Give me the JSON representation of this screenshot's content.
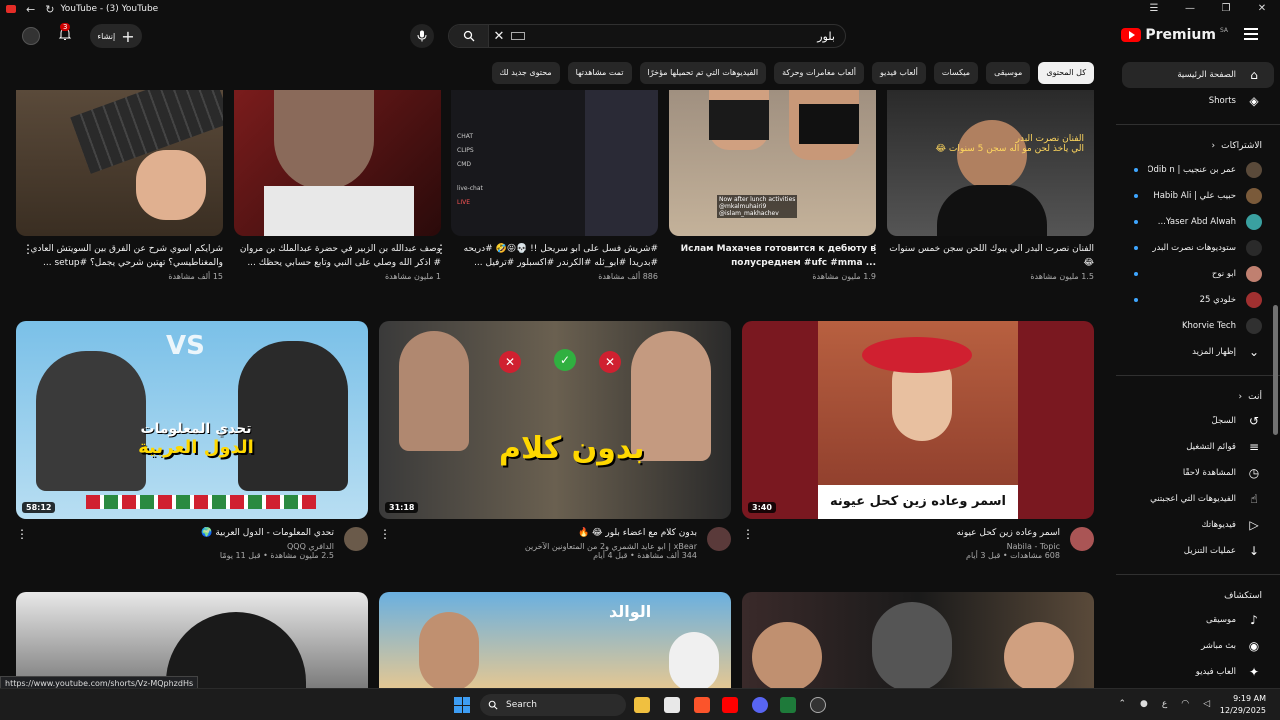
{
  "window": {
    "title": "YouTube - (3) YouTube",
    "back": "←",
    "reload": "↻",
    "controls": [
      "☰",
      "—",
      "❐",
      "✕"
    ]
  },
  "masthead": {
    "logo_text": "Premium",
    "region": "SA",
    "search_value": "بلور",
    "create_label": "إنشاء",
    "create_plus": "+",
    "notification_count": "3"
  },
  "chips": [
    "كل المحتوى",
    "موسيقى",
    "ميكسات",
    "ألعاب فيديو",
    "ألعاب مغامرات وحركة",
    "الفيديوهات التي تم تحميلها مؤخرًا",
    "تمت مشاهدتها",
    "محتوى جديد لك"
  ],
  "sidebar": {
    "main": [
      {
        "label": "الصفحة الرئيسية",
        "icon": "home-icon"
      },
      {
        "label": "Shorts",
        "icon": "shorts-icon"
      }
    ],
    "subs_title": "الاشتراكات",
    "subs_chev": "‹",
    "subs": [
      {
        "label": "عمر بن عنجيب | Odib n...",
        "color": "#5a4a3a"
      },
      {
        "label": "حبيب علي | Habib Ali",
        "color": "#7a5a3a"
      },
      {
        "label": "Yaser Abd Alwah...",
        "color": "#3aa0a0"
      },
      {
        "label": "ستوديوهات نصرت البدر",
        "color": "#2a2a2a"
      },
      {
        "label": "ابو نوح",
        "color": "#c08070"
      },
      {
        "label": "خلودي 25",
        "color": "#a03030"
      },
      {
        "label": "Khorvie Tech",
        "color": "#303030"
      }
    ],
    "show_more": "إظهار المزيد",
    "you_title": "أنت",
    "you_chev": "‹",
    "you": [
      {
        "label": "السجلّ",
        "icon": "history-icon",
        "glyph": "↺"
      },
      {
        "label": "قوائم التشغيل",
        "icon": "playlists-icon",
        "glyph": "≡"
      },
      {
        "label": "المشاهدة لاحقًا",
        "icon": "watch-later-icon",
        "glyph": "◷"
      },
      {
        "label": "الفيديوهات التي أعجبتني",
        "icon": "like-icon",
        "glyph": "☝"
      },
      {
        "label": "فيديوهاتك",
        "icon": "your-videos-icon",
        "glyph": "▷"
      },
      {
        "label": "عمليات التنزيل",
        "icon": "download-icon",
        "glyph": "↓"
      }
    ],
    "explore_title": "استكشاف",
    "explore": [
      {
        "label": "موسيقى",
        "icon": "music-icon",
        "glyph": "♪"
      },
      {
        "label": "بث مباشر",
        "icon": "live-icon",
        "glyph": "◉"
      },
      {
        "label": "ألعاب فيديو",
        "icon": "gaming-icon",
        "glyph": "✦"
      }
    ]
  },
  "row1": [
    {
      "title": "الفنان نصرت البدر الي يبوك اللحن سجن خمس سنوات 😂",
      "views": "1.5 مليون مشاهدة",
      "bg": "#3a3a3a"
    },
    {
      "title": "Ислам Махачев готовится к дебюту в полусреднем #ufc #mma ...",
      "views": "1.9 مليون مشاهدة",
      "bg": "#8a7a66"
    },
    {
      "title": "#شريش فسل على ابو سريحل !! 💀😝🤣 #دريحه #بدريدا #ابو_ثله #الكرندر #اكسبلور #ترفيل ...",
      "views": "886 ألف مشاهدة",
      "bg": "#1a1a1f"
    },
    {
      "title": "وصف عبدالله بن الزبير في حضرة عبدالملك بن مروان # اذكر الله وصلي على النبي وتابع حسابي يحظك ...",
      "views": "1 مليون مشاهدة",
      "bg": "#6a2a2a"
    },
    {
      "title": "شرايكم اسوي شرح عن الفرق بين السويتش العادي والمغناطيسي؟ تهتين شرحي يجمل؟ #setup ...",
      "views": "15 ألف مشاهدة",
      "bg": "#4a3a2a"
    }
  ],
  "row1_labels": {
    "live_chat": "live-chat",
    "chat": "CHAT",
    "clips": "CLIPS",
    "cmd": "CMD",
    "live": "LIVE",
    "caption_a": "الفنان نصرت البدر",
    "caption_b": "الي ياخذ لحن مو اله سجن 5 سنوات 😂",
    "watermark_a": "Now after lunch activities",
    "watermark_b": "@mkalmuhairi9",
    "watermark_c": "@islam_makhachev"
  },
  "row2": [
    {
      "title": "اسمر وعاده زين كحل عيونه",
      "channel": "Nabila - Topic",
      "views": "608 مشاهدات • قبل 3 أيام",
      "duration": "3:40",
      "thumb_text": "اسمر وعاده زين كحل عيونه",
      "av": "#aa5555"
    },
    {
      "title": "بدون كلام مع اعضاء بلور 😂 🔥",
      "channel": "xBear | ابو عايد الشمري و2 من المتعاونين الآخرين",
      "views": "344 ألف مشاهدة • قبل 4 أيام",
      "duration": "31:18",
      "thumb_text": "بدون كلام",
      "av": "#5a3a3a"
    },
    {
      "title": "تحدي المعلومات - الدول العربية 🌍",
      "channel": "الدافري QQQ",
      "views": "2.5 مليون مشاهدة • قبل 11 يومًا",
      "duration": "58:12",
      "thumb_text": "تحدي المعلومات",
      "thumb_text2": "الدول العربية",
      "thumb_vs": "VS",
      "av": "#6a5a4a"
    }
  ],
  "row3_labels": {
    "father": "الوالد"
  },
  "status_url": "https://www.youtube.com/shorts/Vz-MQphzdHs",
  "taskbar": {
    "search": "Search",
    "time": "9:19 AM",
    "date": "12/29/2025",
    "lang": "ع"
  },
  "colors": {
    "accent": "#ff0000",
    "bg": "#0f0f0f",
    "chip": "#272727"
  }
}
